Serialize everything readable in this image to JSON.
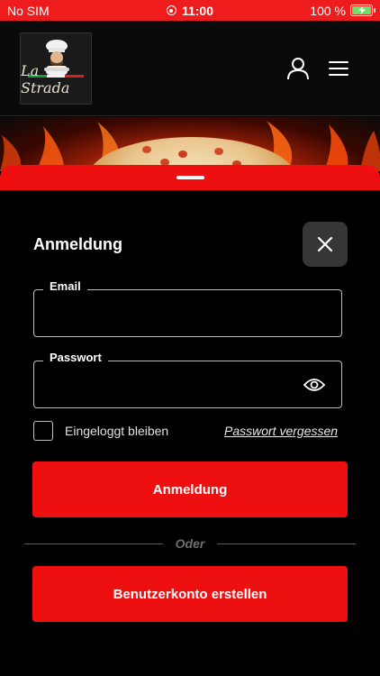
{
  "status_bar": {
    "carrier": "No SIM",
    "time": "11:00",
    "battery": "100 %",
    "battery_level": 1.0
  },
  "header": {
    "logo_text": "La Strada",
    "icons": [
      "user-icon",
      "menu-icon"
    ]
  },
  "login": {
    "title": "Anmeldung",
    "email_label": "Email",
    "email_value": "",
    "password_label": "Passwort",
    "password_value": "",
    "remember_label": "Eingeloggt bleiben",
    "remember_checked": false,
    "forgot_password": "Passwort vergessen",
    "login_button": "Anmeldung",
    "divider_text": "Oder",
    "register_button": "Benutzerkonto erstellen"
  },
  "colors": {
    "accent": "#ee1010",
    "background": "#000000",
    "close_button_bg": "#363636"
  }
}
